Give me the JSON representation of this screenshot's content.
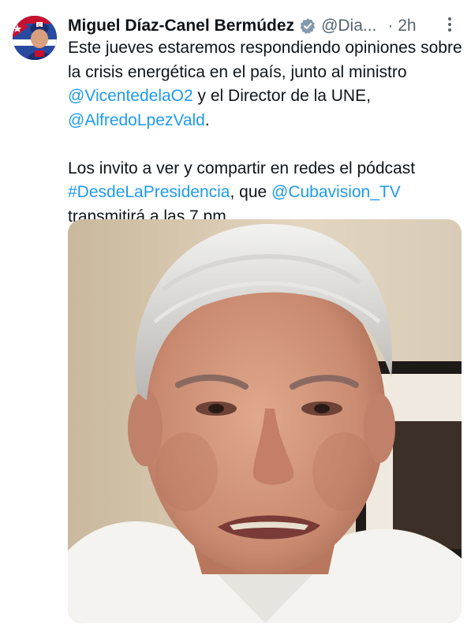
{
  "tweet": {
    "author_name": "Miguel Díaz-Canel Bermúdez",
    "handle": "@Dia...",
    "time": "· 2h",
    "verified": true,
    "more_icon": "more-vertical-icon",
    "text": {
      "line1_a": "Este jueves estaremos respondiendo opiniones sobre la crisis energética en el país, junto al ministro ",
      "mention1": "@VicentedelaO2",
      "line1_b": " y el Director de la UNE, ",
      "mention2": "@AlfredoLpezVald",
      "line1_c": ".",
      "line2_a": "Los invito a ver y compartir en redes el pódcast ",
      "hashtag": "#DesdeLaPresidencia",
      "line2_b": ", que ",
      "mention3": "@Cubavision_TV",
      "line2_c": " transmitirá a las 7 pm."
    },
    "media": {
      "kind": "photo"
    }
  },
  "colors": {
    "link": "#1d9bf0",
    "secondary_text": "#536471",
    "primary_text": "#0f1419",
    "verified_badge": "#829aab"
  }
}
